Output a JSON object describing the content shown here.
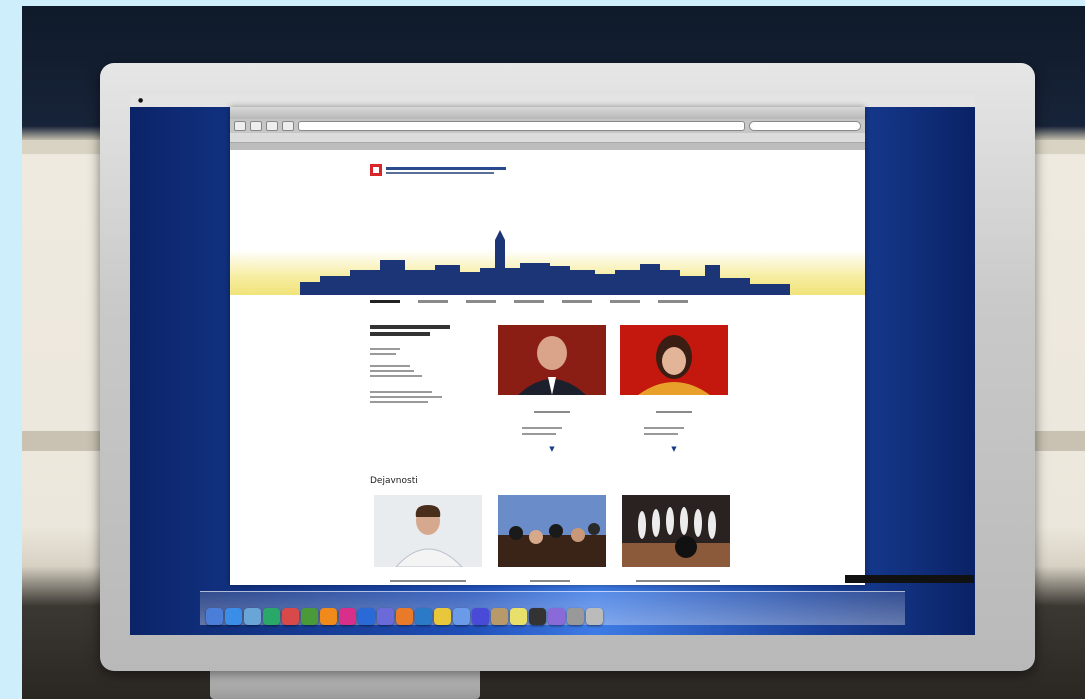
{
  "browser": {
    "window_title": "",
    "url": ""
  },
  "page": {
    "section_title": "Dejavnosti"
  },
  "os": {
    "menubar_items": [
      "",
      "",
      "",
      "",
      "",
      "",
      ""
    ],
    "dock_icons": [
      "finder-icon",
      "safari-icon",
      "preview-icon",
      "itunes-icon",
      "ical-icon",
      "dreamweaver-icon",
      "illustrator-icon",
      "indesign-icon",
      "photoshop-icon",
      "bridge-icon",
      "firefox-icon",
      "thunderbird-icon",
      "chrome-icon",
      "mail-icon",
      "ichat-icon",
      "addressbook-icon",
      "notes-icon",
      "terminal-icon",
      "photo-icon",
      "system-prefs-icon",
      "trash-icon"
    ],
    "dock_colors": [
      "#4a7ed8",
      "#3a8ee8",
      "#6aa5d8",
      "#2aa86a",
      "#d84a4a",
      "#4a9a3a",
      "#f08a1a",
      "#d8308a",
      "#2a6ad8",
      "#6a6ad8",
      "#e87a2a",
      "#2a7ac8",
      "#e8c83a",
      "#6a9ae8",
      "#4a4ad8",
      "#b89a6a",
      "#e8e06a",
      "#333333",
      "#8a6ad8",
      "#999999",
      "#bbbbbb"
    ]
  },
  "colors": {
    "skyline": "#1b3577",
    "horizon": "#f2e37a",
    "desktop": "#1f4fb8"
  }
}
